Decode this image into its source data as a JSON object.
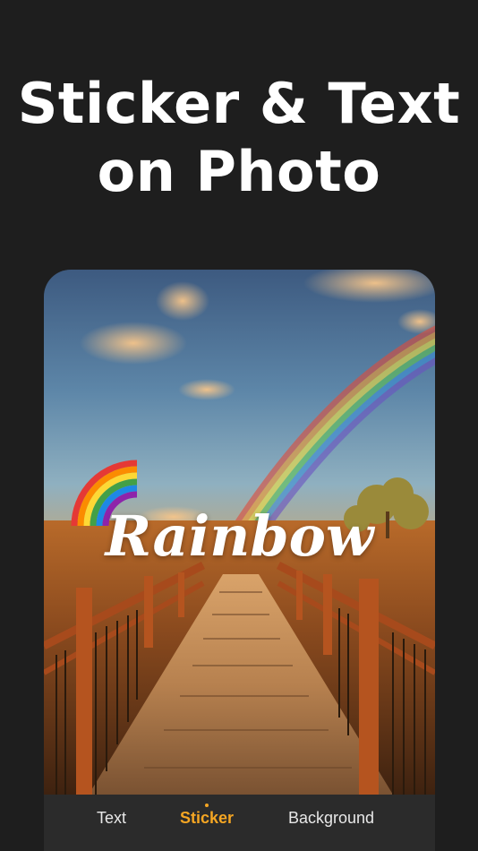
{
  "headline": {
    "line1": "Sticker & Text",
    "line2": "on Photo"
  },
  "photo": {
    "scene": "wooden boardwalk under rainbow at sunset",
    "sticker_icon": "rainbow-emoji",
    "sticker_text": "Rainbow"
  },
  "tabs": [
    {
      "label": "Text",
      "active": false
    },
    {
      "label": "Sticker",
      "active": true
    },
    {
      "label": "Background",
      "active": false
    }
  ],
  "colors": {
    "background": "#1e1e1e",
    "accent": "#f5a623",
    "tabbar": "#2b2b2b"
  }
}
